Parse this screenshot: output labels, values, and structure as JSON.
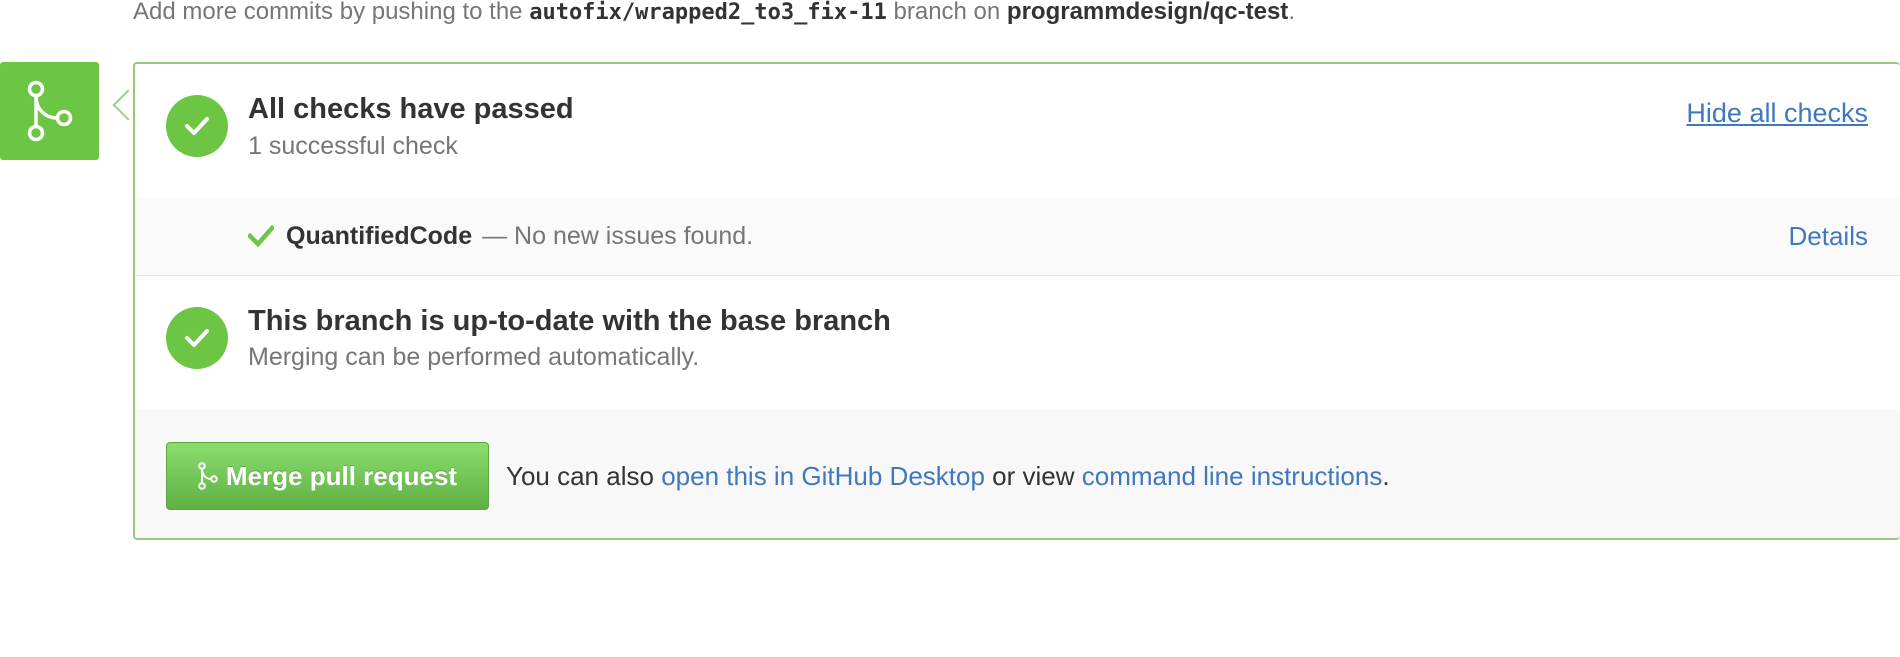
{
  "notice": {
    "prefix": "Add more commits by pushing to the",
    "branch": "autofix/wrapped2_to3_fix-11",
    "middle": "branch on",
    "repo": "programmdesign/qc-test",
    "suffix": "."
  },
  "checks_status": {
    "title": "All checks have passed",
    "subtitle": "1 successful check",
    "toggle_label": "Hide all checks"
  },
  "check_item": {
    "name": "QuantifiedCode",
    "description": "— No new issues found.",
    "details_label": "Details"
  },
  "branch_status": {
    "title": "This branch is up-to-date with the base branch",
    "subtitle": "Merging can be performed automatically."
  },
  "merge": {
    "button_label": "Merge pull request",
    "note_prefix": "You can also",
    "desktop_link": "open this in GitHub Desktop",
    "note_middle": "or view",
    "cli_link": "command line instructions",
    "note_suffix": "."
  },
  "icons": {
    "merge": "git-merge-icon",
    "success": "check-circle-icon",
    "check": "check-icon"
  },
  "colors": {
    "success": "#6cc644",
    "link": "#4078c0",
    "panel_border": "#95c97e"
  }
}
